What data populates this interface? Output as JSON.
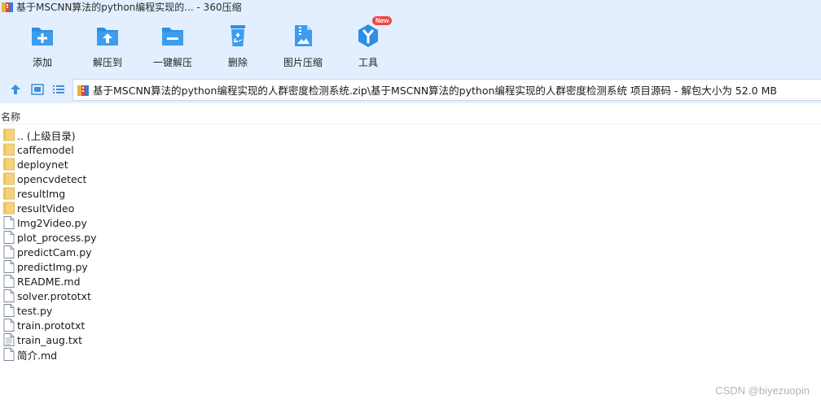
{
  "window": {
    "title": "基于MSCNN算法的python编程实现的... - 360压缩"
  },
  "toolbar": {
    "add_label": "添加",
    "extract_to_label": "解压到",
    "one_click_extract_label": "一键解压",
    "delete_label": "删除",
    "image_compress_label": "图片压缩",
    "tools_label": "工具",
    "new_badge": "New"
  },
  "address": {
    "path": "基于MSCNN算法的python编程实现的人群密度检测系统.zip\\基于MSCNN算法的python编程实现的人群密度检测系统 项目源码 - 解包大小为 52.0 MB"
  },
  "list": {
    "header_name": "名称",
    "items": [
      {
        "name": ".. (上级目录)",
        "type": "folder"
      },
      {
        "name": "caffemodel",
        "type": "folder"
      },
      {
        "name": "deploynet",
        "type": "folder"
      },
      {
        "name": "opencvdetect",
        "type": "folder"
      },
      {
        "name": "resultImg",
        "type": "folder"
      },
      {
        "name": "resultVideo",
        "type": "folder"
      },
      {
        "name": "Img2Video.py",
        "type": "file"
      },
      {
        "name": "plot_process.py",
        "type": "file"
      },
      {
        "name": "predictCam.py",
        "type": "file"
      },
      {
        "name": "predictImg.py",
        "type": "file"
      },
      {
        "name": "README.md",
        "type": "file"
      },
      {
        "name": "solver.prototxt",
        "type": "file"
      },
      {
        "name": "test.py",
        "type": "file"
      },
      {
        "name": "train.prototxt",
        "type": "file"
      },
      {
        "name": "train_aug.txt",
        "type": "textfile"
      },
      {
        "name": "简介.md",
        "type": "file"
      }
    ]
  },
  "watermark": "CSDN @biyezuopin",
  "colors": {
    "toolbar_bg": "#e3efff",
    "icon_blue": "#2e8ee6",
    "folder_yellow": "#f5d37a",
    "badge_red": "#f2453d"
  }
}
